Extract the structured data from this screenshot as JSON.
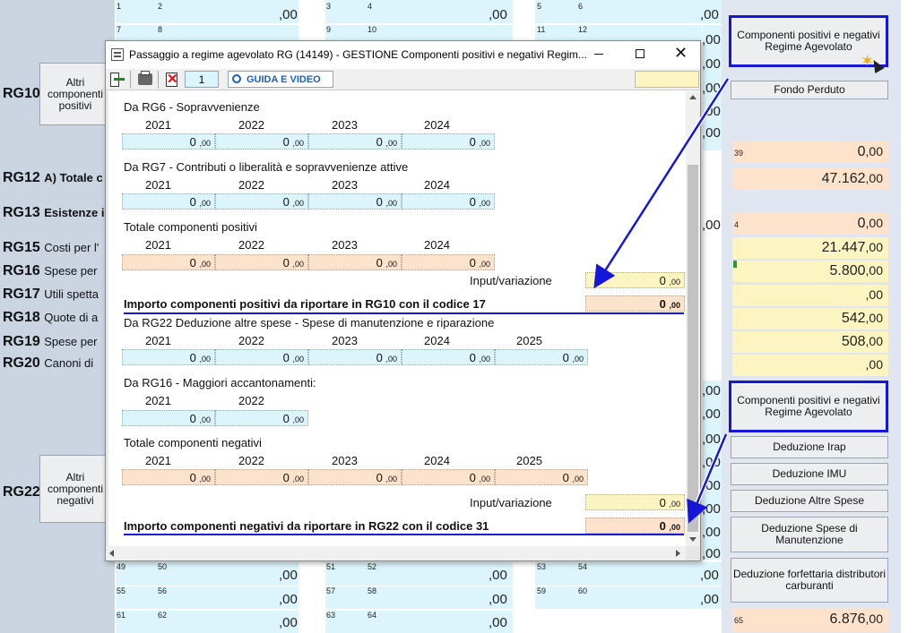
{
  "window": {
    "title": "Passaggio a regime agevolato RG (14149) - GESTIONE Componenti positivi e negativi Regim...",
    "page": "1",
    "guide": "GUIDA E VIDEO"
  },
  "left_labels": [
    {
      "code": "RG10",
      "text": ""
    },
    {
      "code": "RG12",
      "text": "A) Totale c"
    },
    {
      "code": "RG13",
      "text": "Esistenze i"
    },
    {
      "code": "RG15",
      "text": "Costi per l'"
    },
    {
      "code": "RG16",
      "text": "Spese per"
    },
    {
      "code": "RG17",
      "text": "Utili spetta"
    },
    {
      "code": "RG18",
      "text": "Quote di a"
    },
    {
      "code": "RG19",
      "text": "Spese per"
    },
    {
      "code": "RG20",
      "text": "Canoni di"
    },
    {
      "code": "RG22",
      "text": ""
    }
  ],
  "left_buttons": {
    "pos": "Altri componenti positivi",
    "neg": "Altri componenti negativi"
  },
  "bg_top": {
    "r1": [
      "1",
      "2",
      "3",
      "4",
      "5",
      "6"
    ],
    "r2": [
      "7",
      "8",
      "9",
      "10",
      "11",
      "12"
    ],
    "zero": ",00"
  },
  "bg_bottom": {
    "r1": [
      "49",
      "50",
      "51",
      "52",
      "53",
      "54"
    ],
    "r2": [
      "55",
      "56",
      "57",
      "58",
      "59",
      "60"
    ],
    "r3": [
      "61",
      "62",
      "63",
      "64"
    ],
    "zero": ",00"
  },
  "right_buttons": {
    "comp_top": "Componenti positivi e negativi Regime Agevolato",
    "fondo": "Fondo Perduto",
    "comp_bot": "Componenti positivi e negativi Regime Agevolato",
    "irap": "Deduzione Irap",
    "imu": "Deduzione IMU",
    "altre": "Deduzione Altre Spese",
    "manut": "Deduzione Spese di Manutenzione",
    "forf": "Deduzione forfettaria distributori carburanti"
  },
  "right_values": {
    "n39": "39",
    "v39": "0",
    "v12": "47.162",
    "n4": "4",
    "v4": "0",
    "v15": "21.447",
    "v16": "5.800",
    "v18": "542",
    "v19": "508",
    "n65": "65",
    "v65": "6.876",
    "dec": ",00"
  },
  "dialog": {
    "sec1": "Da RG6 - Sopravvenienze",
    "sec2": "Da RG7 - Contributi o liberalità e sopravvenienze attive",
    "sec3": "Totale componenti positivi",
    "years4": [
      "2021",
      "2022",
      "2023",
      "2024"
    ],
    "years5": [
      "2021",
      "2022",
      "2023",
      "2024",
      "2025"
    ],
    "years2": [
      "2021",
      "2022"
    ],
    "zero": "0",
    "dec": ",00",
    "input_lbl": "Input/variazione",
    "pos_total_lbl": "Importo componenti positivi da riportare in RG10 con il codice 17",
    "sec4": "Da RG22 Deduzione altre spese - Spese di manutenzione e riparazione",
    "sec5": "Da RG16 - Maggiori accantonamenti:",
    "sec6": "Totale componenti negativi",
    "neg_total_lbl": "Importo componenti negativi da riportare in RG22 con il codice 31"
  },
  "colors": {
    "accent": "#1616d8",
    "blue": "#dcf4fb",
    "peach": "#fde3cc",
    "yellow": "#fdf5c1"
  }
}
